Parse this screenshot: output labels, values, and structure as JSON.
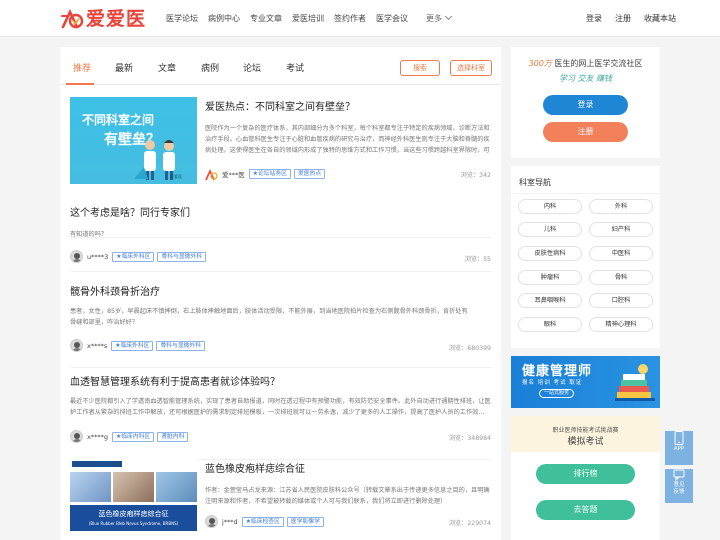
{
  "brand": {
    "logo_text": "爱爱医"
  },
  "nav": {
    "items": [
      "医学论坛",
      "病例中心",
      "专业文章",
      "爱医培训",
      "签约作者",
      "医学会议"
    ],
    "more": "更多"
  },
  "user_links": [
    "登录",
    "注册",
    "收藏本站"
  ],
  "tabs": [
    "推荐",
    "最新",
    "文章",
    "病例",
    "论坛",
    "考试"
  ],
  "buttons": {
    "search": "搜索",
    "choose_dept": "选择科室"
  },
  "posts": [
    {
      "title": "爱医热点：不同科室之间有壁垒？",
      "excerpt": "医院作为一个复杂的医疗体系，其内部细分为多个科室，每个科室都专注于特定的疾病领域、诊断方法和治疗手段。心血管科医生专注于心脏和血管疾病的研究与治疗，而神经外科医生则专注于大脑和脊髓的疾病处理。这使得医生在各自的领域内形成了独特的思维方式和工作习惯，当这些习惯跨越科室界限时，可能会...",
      "thumb_line1": "不同科室之间",
      "thumb_line2": "有壁垒？",
      "thumb_brand": "爱爱医",
      "user": "爱***医",
      "tags": [
        "论坛站务区",
        "爱医热点"
      ],
      "views": "浏览：342"
    },
    {
      "title": "这个考虑是啥？同行专家们",
      "excerpt": "有知道的吗？",
      "user": "u****3",
      "tags": [
        "临床外科区",
        "骨科与显微外科"
      ],
      "views": "浏览：55"
    },
    {
      "title": "髋骨外科颈骨折治疗",
      "excerpt": "患者，女性，85岁，早晨起床不慎摔倒，右上肢体摔触地面后，肢体活动受限，不能外展，到当地医院拍片检查为右侧髋骨外科颈骨折，肯折处有骨缝和部里，咋治好好？",
      "user": "x****s",
      "tags": [
        "临床外科区",
        "骨科与显微外科"
      ],
      "views": "浏览：680399"
    },
    {
      "title": "血透智慧管理系统有利于提高患者就诊体验吗？",
      "excerpt": "最近不少医院都引入了学透南血透智能管理系统，实现了患者自助报道，同时在透过程中有预警功能，有效防范安全事件。此外自动进行通期性排班，让医护工作者从繁杂的排班工作中解放，还可根据医护的需求制定排班模板，一次排班就可以一劳永逸，减少了更多的人工操作，提高了医护人员的工作效...",
      "user": "x****g",
      "tags": [
        "临床内科区",
        "肾脏内科"
      ],
      "views": "浏览：348984"
    },
    {
      "title": "蓝色橡皮疱样痣综合征",
      "excerpt": "作者：金萱莹马占龙来源：江苏省人民医院皮肤科公众号（转载文章系出于传递更多信息之目的，且明确注明来源和作者，不希望被转载的媒体或个人可与我们联系，我们将立即进行删除处理）",
      "thumb_overlay": "蓝色橡皮疱样痣综合征",
      "thumb_overlay_sub": "(Blue Rubber Bleb Nevus Syndrome, BRBNS)",
      "user": "j***d",
      "tags": [
        "临床检查区",
        "医学影像学"
      ],
      "views": "浏览：229074"
    }
  ],
  "sidebar": {
    "promo_prefix": "300万",
    "promo_rest": " 医生的网上医学交流社区",
    "slogan": "学习 交友 赚钱",
    "login": "登录",
    "register": "注册",
    "dept_nav_title": "科室导航",
    "departments": [
      "内科",
      "外科",
      "儿科",
      "妇产科",
      "皮肤性病科",
      "中医科",
      "肿瘤科",
      "骨科",
      "耳鼻咽喉科",
      "口腔科",
      "眼科",
      "精神心理科"
    ]
  },
  "health_banner": {
    "title": "健康管理师",
    "sub": "报名 培训 考试 取证",
    "pill": "一站式服务"
  },
  "exam": {
    "banner_line1": "职业医师技能考试挑战赛",
    "banner_line2": "模拟考试",
    "rank": "排行榜",
    "answer": "去答题"
  },
  "floatbar": [
    "APP",
    "意见反馈",
    "回到顶部"
  ],
  "colors": {
    "brand_red": "#e8443b",
    "accent_orange": "#f07a4a",
    "login_blue": "#1f86d6",
    "register_orange": "#f2805b",
    "exam_green": "#3fc09a",
    "tag_blue": "#3b7bd6"
  }
}
